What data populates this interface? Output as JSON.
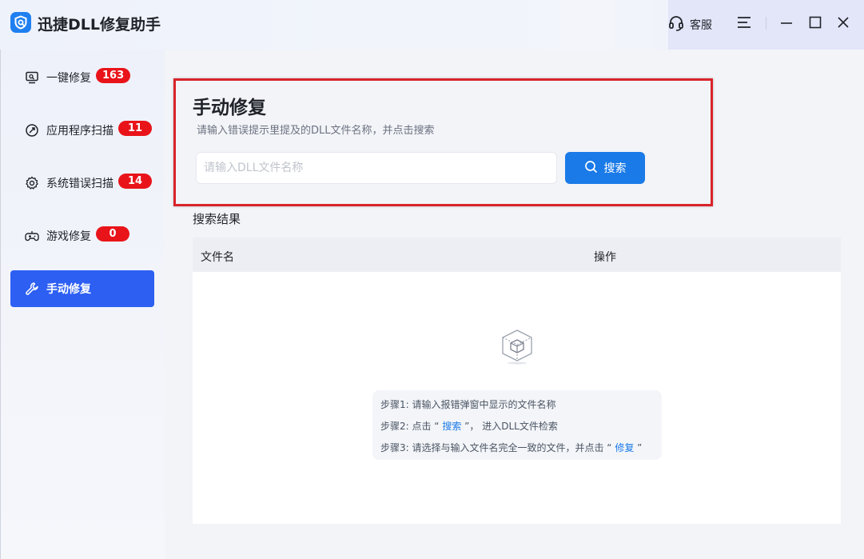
{
  "app": {
    "title": "迅捷DLL修复助手"
  },
  "titlebar": {
    "support_label": "客服"
  },
  "sidebar": {
    "items": [
      {
        "label": "一键修复",
        "badge": "163",
        "icon": "monitor-repair-icon"
      },
      {
        "label": "应用程序扫描",
        "badge": "11",
        "icon": "app-scan-icon"
      },
      {
        "label": "系统错误扫描",
        "badge": "14",
        "icon": "gear-icon"
      },
      {
        "label": "游戏修复",
        "badge": "0",
        "icon": "gamepad-icon"
      },
      {
        "label": "手动修复",
        "icon": "wrench-icon",
        "active": true
      }
    ]
  },
  "manual": {
    "title": "手动修复",
    "subtitle": "请输入错误提示里提及的DLL文件名称，并点击搜索",
    "search_placeholder": "请输入DLL文件名称",
    "search_value": "",
    "search_button": "搜索"
  },
  "results": {
    "title": "搜索结果",
    "columns": [
      "文件名",
      "操作"
    ],
    "rows": []
  },
  "steps": {
    "s1": "步骤1: 请输入报错弹窗中显示的文件名称",
    "s2_prefix": "步骤2: 点击 “ ",
    "s2_link": "搜索",
    "s2_suffix": " ”， 进入DLL文件检索",
    "s3_prefix": "步骤3: 请选择与输入文件名完全一致的文件，并点击 “ ",
    "s3_link": "修复",
    "s3_suffix": " ”"
  },
  "colors": {
    "accent": "#1a7ae8",
    "nav_active": "#2d5ff3",
    "badge": "#e8141a",
    "highlight_border": "#d9232b"
  }
}
